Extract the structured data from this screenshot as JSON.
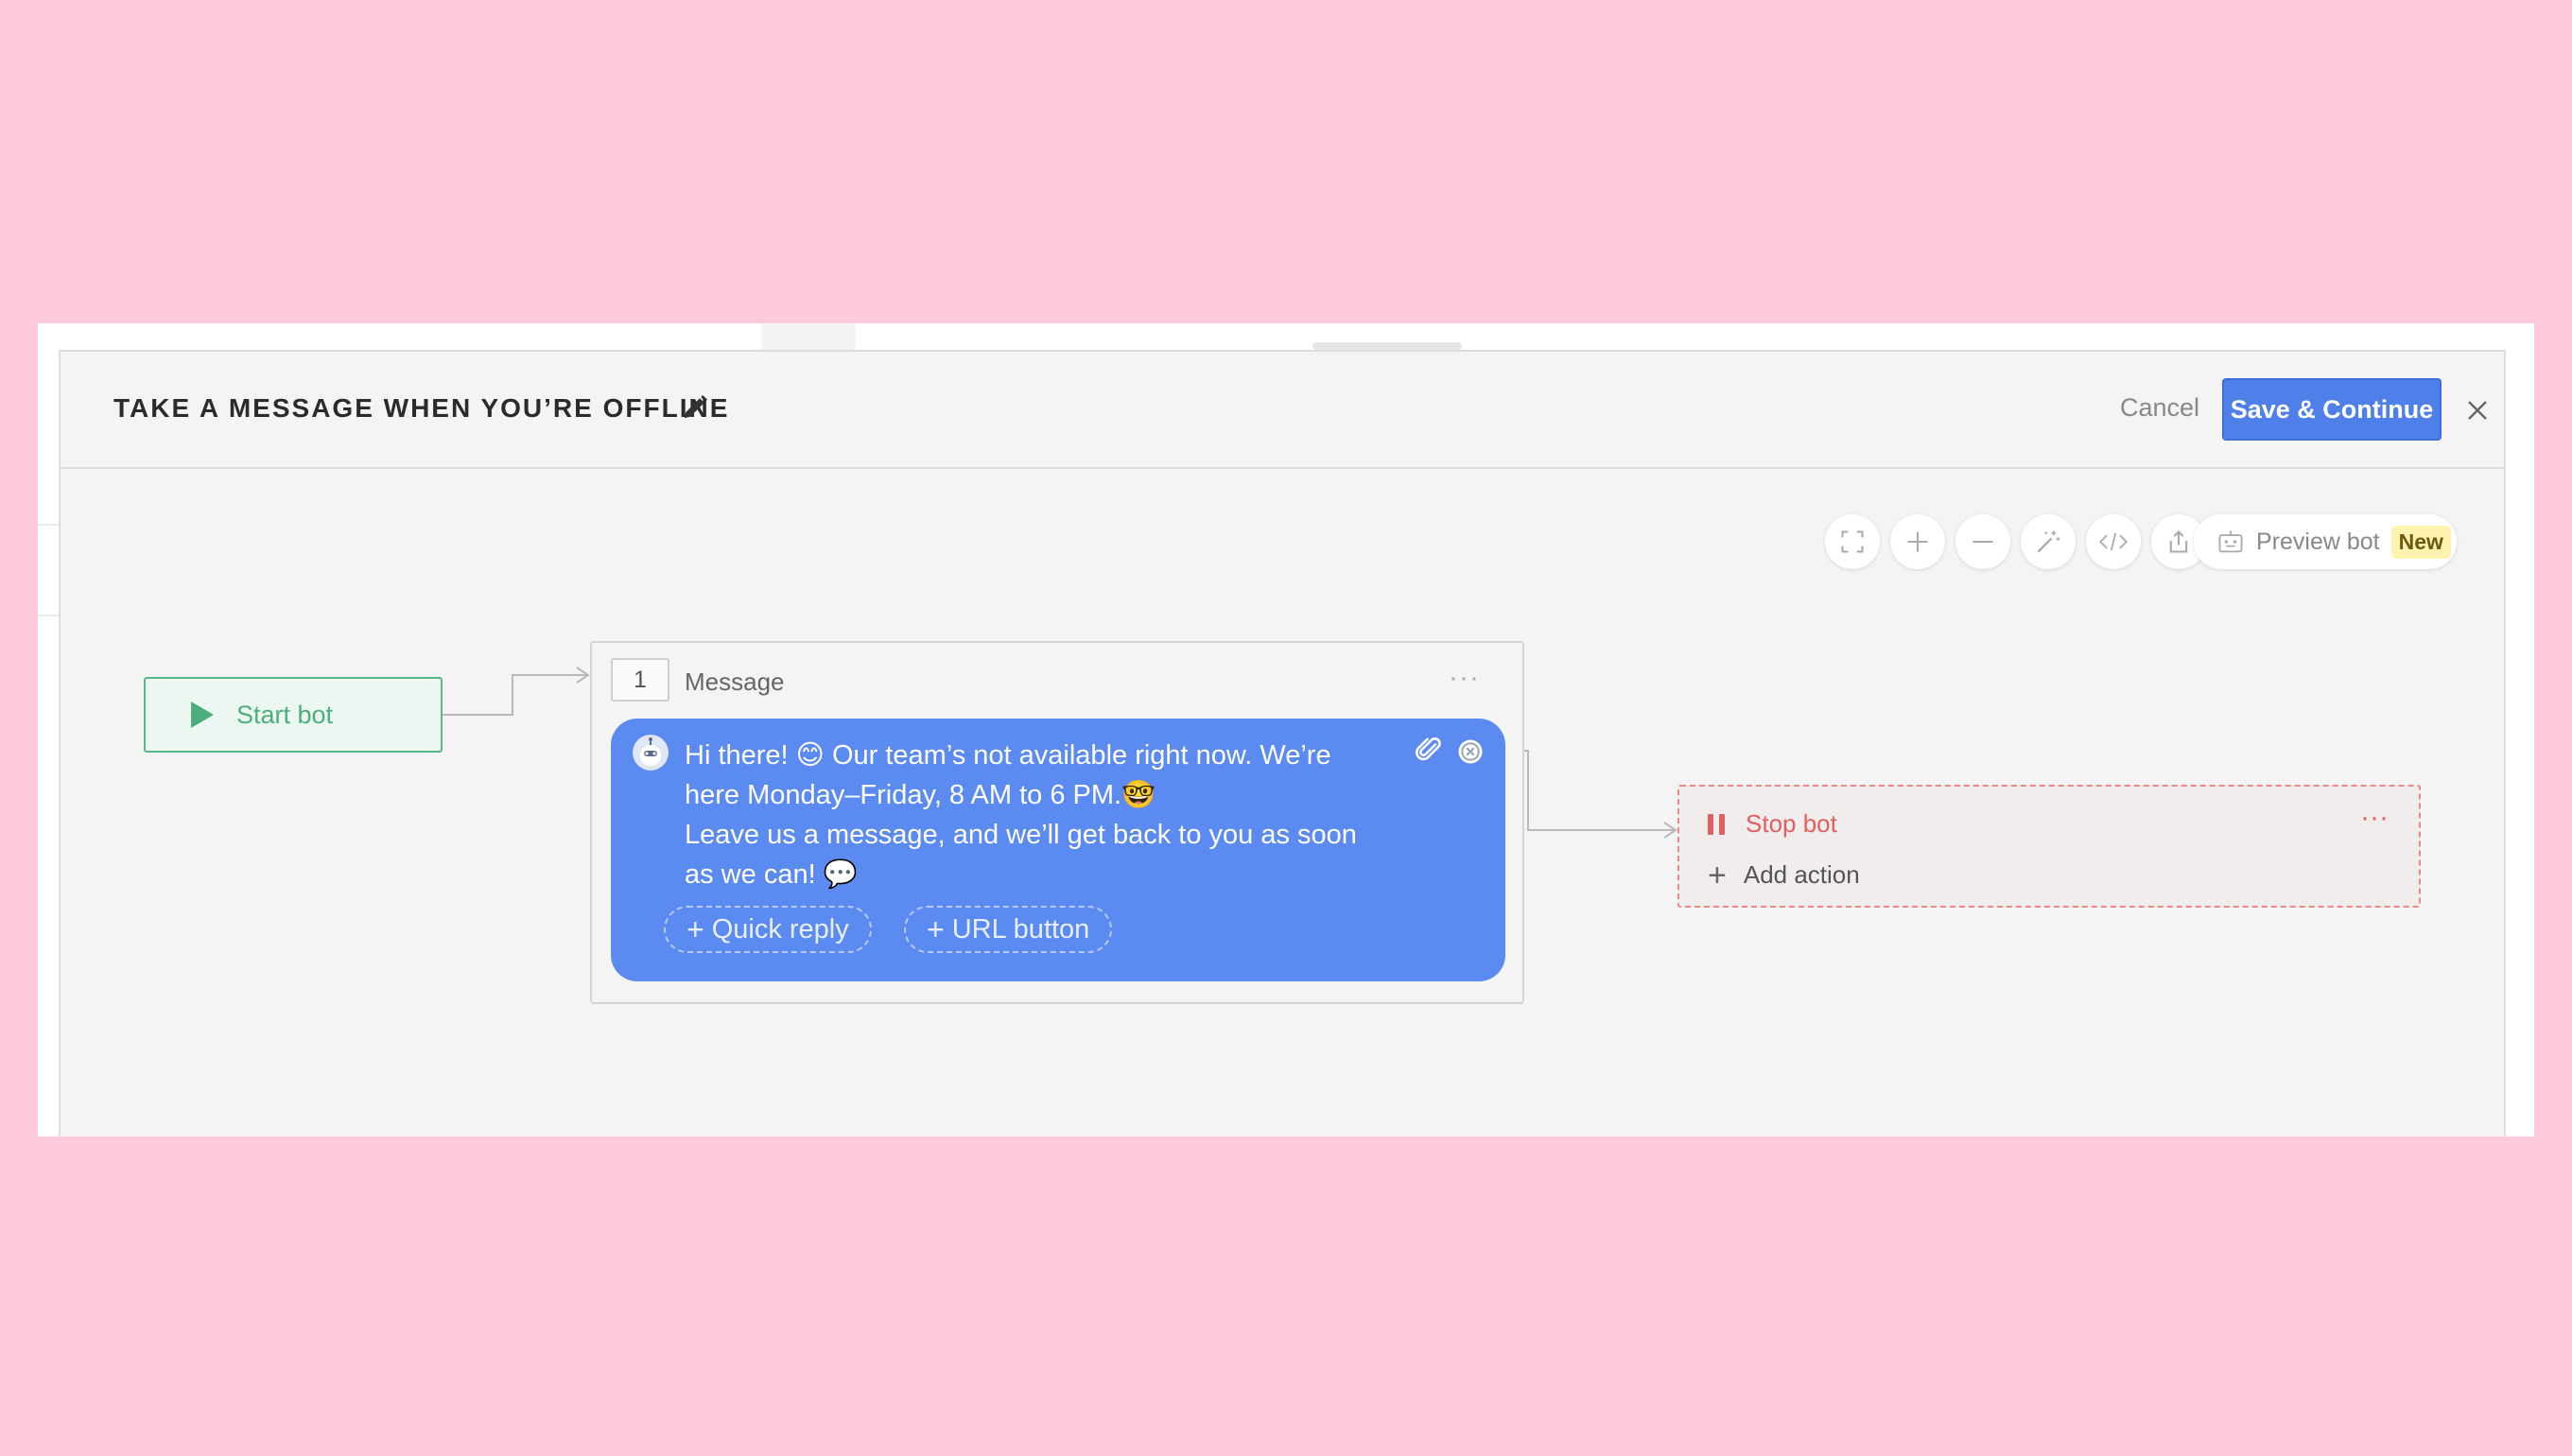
{
  "header": {
    "title": "TAKE A MESSAGE WHEN YOU’RE OFFLINE",
    "edit_icon": "pencil-icon",
    "cancel_label": "Cancel",
    "save_label": "Save & Continue",
    "close_icon": "close-icon"
  },
  "toolbar": {
    "buttons": [
      {
        "name": "fullscreen",
        "icon": "expand-icon"
      },
      {
        "name": "zoom-in",
        "icon": "plus-icon"
      },
      {
        "name": "zoom-out",
        "icon": "minus-icon"
      },
      {
        "name": "auto-arrange",
        "icon": "magic-wand-icon"
      },
      {
        "name": "embed-code",
        "icon": "code-icon"
      },
      {
        "name": "export",
        "icon": "share-icon"
      }
    ],
    "preview_label": "Preview bot",
    "preview_badge": "New"
  },
  "flow": {
    "start_label": "Start bot",
    "message_step": {
      "number": "1",
      "title": "Message",
      "menu": "···",
      "text": "Hi there! 😊 Our team’s not available right now. We’re\nhere Monday–Friday, 8 AM to 6 PM.🤓\nLeave us a message, and we’ll get back to you as soon\nas we can! 💬",
      "quick_reply_label": "Quick reply",
      "url_button_label": "URL button"
    },
    "stop_step": {
      "label": "Stop bot",
      "menu": "···",
      "add_action_label": "Add action"
    }
  },
  "colors": {
    "page_background": "#ffc9de",
    "primary": "#4f80ea",
    "bubble": "#5b8af0",
    "start_green": "#4cae7c",
    "stop_red": "#e25f5f",
    "badge_yellow": "#fff3b0"
  }
}
